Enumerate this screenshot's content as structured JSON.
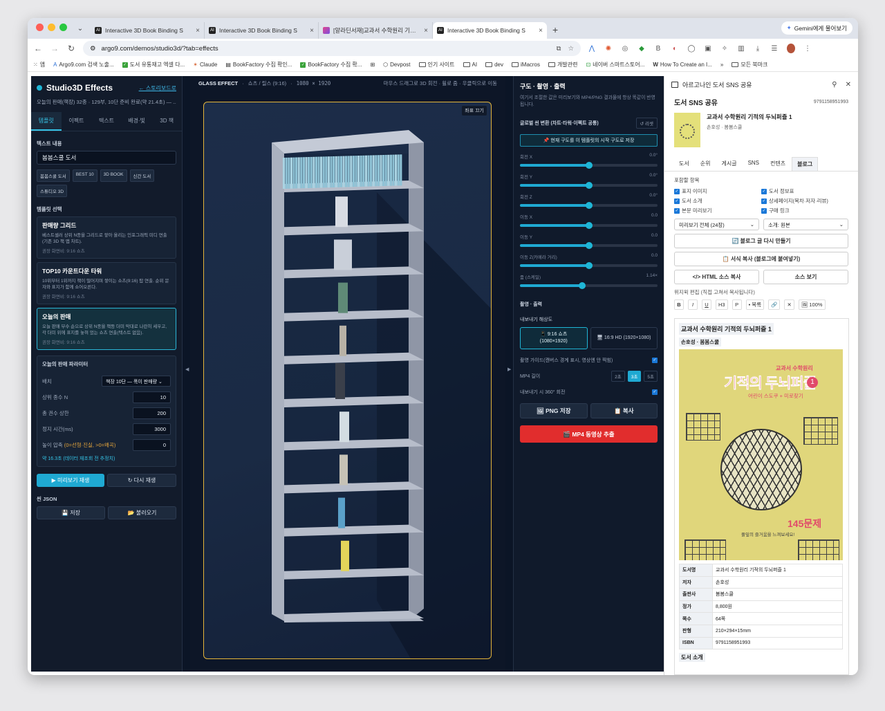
{
  "browser": {
    "tabs": [
      {
        "title": "Interactive 3D Book Binding S",
        "icon": "AI",
        "active": false
      },
      {
        "title": "Interactive 3D Book Binding S",
        "icon": "AI",
        "active": false
      },
      {
        "title": "[알라딘서재]교과서 수학원리 기적의",
        "icon": "aladin",
        "active": false
      },
      {
        "title": "Interactive 3D Book Binding S",
        "icon": "AI",
        "active": true
      }
    ],
    "new_tab": "+",
    "gemini_label": "Gemini에게 물어보기",
    "url": "argo9.com/demos/studio3d/?tab=effects",
    "bookmarks": [
      "앱",
      "Argo9.com 검색 노출...",
      "도서 유통재고 엑셀 다...",
      "Claude",
      "BookFactory 수집 확인...",
      "BookFactory 수집 확...",
      "Devpost",
      "인기 사이트",
      "AI",
      "dev",
      "iMacros",
      "개발관련",
      "네이버 스마트스토어...",
      "How To Create an I...",
      "모든 북마크"
    ]
  },
  "left": {
    "brand": "Studio3D Effects",
    "back_link": "← 스토리보드로",
    "subtitle": "오늘의 판매(책장) 32종 · 129부, 10단 준비 완료(약 21.4초) — ...",
    "tabs": [
      "템플릿",
      "이펙트",
      "텍스트",
      "배경·빛",
      "3D 책"
    ],
    "active_tab": 0,
    "text_label": "텍스트 내용",
    "text_value": "봄봄스쿨 도서",
    "chips": [
      "봄봄스쿨 도서",
      "BEST 10",
      "3D BOOK",
      "신간 도서",
      "스튜디오 3D"
    ],
    "template_label": "템플릿 선택",
    "templates": [
      {
        "title": "판매량 그리드",
        "desc": "베스트셀러 상위 N종을 그리드로 쌓아 올리는 인포그래픽 미디 연출 (기존 3D 책 맵 차트).",
        "rec": "권장 화면비: 9:16 쇼츠"
      },
      {
        "title": "TOP10 카운트다운 타워",
        "desc": "10위부터 1위까지 책이 떨어지며 쌓이는 쇼츠(9:16) 탑 연출. 순위 문자와 표지가 함께 쇼어오른다.",
        "rec": "권장 화면비: 9:16 쇼츠"
      },
      {
        "title": "오늘의 판매",
        "desc": "오늘 판매 부수 순으로 상위 N종을 책등 더미 막대로 나란히 세우고, 각 더미 위에 표지를 놓혀 었는 쇼츠 연출(텍스트 없음).",
        "rec": "권장 화면비: 9:16 쇼츠"
      }
    ],
    "active_template": 2,
    "params_title": "오늘의 판매 파라미터",
    "params": {
      "layout_label": "배치",
      "layout_value": "책장 10단 — 폭이 판매량",
      "topn_label": "상위 종수 N",
      "topn_value": "10",
      "total_label": "총 권수 상한",
      "total_value": "200",
      "stop_label": "정지 시간(ms)",
      "stop_value": "3000",
      "height_label": "높이 압축",
      "height_hint": "(0=선형·진실, >0=왜곡)",
      "height_value": "0",
      "estimate": "약 16.3초 (데이터 재조회 전 추정치)"
    },
    "play_label": "▶ 미리보기 재생",
    "replay_label": "↻ 다시 재생",
    "json_label": "씬 JSON",
    "save_label": "💾 저장",
    "load_label": "📂 불러오기"
  },
  "viewer": {
    "effect": "GLASS EFFECT",
    "mode": "쇼츠 / 릴스 (9:16)",
    "res": "1080 × 1920",
    "hint": "마우스 드래그로 3D 회전 · 휠로 줌 · 우클릭으로 이동",
    "coord_toggle": "좌표 끄기",
    "shelves": 11
  },
  "middle": {
    "title": "구도 · 촬영 · 출력",
    "desc": "여기서 조절한 값은 미리보기와 MP4/PNG 결과물에 항상 똑같이 반영됩니다.",
    "global_title": "글로벌 씬 변환 (차트·타워·이펙트 공통)",
    "reset": "↺ 리셋",
    "save_composition": "📌 현재 구도를 이 템플릿의 시작 구도로 저장",
    "sliders": [
      {
        "label": "회전 X",
        "value": "0.0°",
        "ratio": 0.5
      },
      {
        "label": "회전 Y",
        "value": "0.0°",
        "ratio": 0.5
      },
      {
        "label": "회전 Z",
        "value": "0.0°",
        "ratio": 0.5
      },
      {
        "label": "이동 X",
        "value": "0.0",
        "ratio": 0.5
      },
      {
        "label": "이동 Y",
        "value": "0.0",
        "ratio": 0.5
      },
      {
        "label": "이동 Z(카메라 거리)",
        "value": "0.0",
        "ratio": 0.5
      },
      {
        "label": "줌 (스케일)",
        "value": "1.14×",
        "ratio": 0.45
      }
    ],
    "shoot_title": "촬영 · 출력",
    "res_title": "내보내기 해상도",
    "res_options": [
      "📱 9:16 쇼츠\n(1080×1920)",
      "🖥 16:9 HD (1920×1080)"
    ],
    "guide_label": "촬영 가이드(캔버스 경계 표시, 영상엔 안 찍힘)",
    "mp4_label": "MP4 길이",
    "mp4_options": [
      "2초",
      "3초",
      "5초"
    ],
    "mp4_active": 1,
    "rotate_label": "내보내기 시 360° 회전",
    "png_label": "🖼 PNG 저장",
    "copy_label": "📋 복사",
    "mp4_button": "🎬 MP4 동영상 추출"
  },
  "side": {
    "header": "아르고나인 도서 SNS 공유",
    "title": "도서 SNS 공유",
    "isbn": "9791158951993",
    "book_title": "교과서 수학원리 기적의 두뇌퍼즐 1",
    "book_author": "손호성 · 봄봄스쿨",
    "tabs": [
      "도서",
      "순위",
      "게시글",
      "SNS",
      "컨텐츠",
      "블로그"
    ],
    "active_tab": 5,
    "include_label": "포함할 항목",
    "checks": [
      "표지 이미지",
      "도서 정보표",
      "도서 소개",
      "상세페이지(목차·저자·리뷰)",
      "본문 미리보기",
      "구매 링크"
    ],
    "preview_sel": "미리보기 전체 (24장)",
    "intro_sel": "소개: 원본",
    "remake": "🔄 블로그 글 다시 만들기",
    "copy_format": "📋 서식 복사 (블로그에 붙여넣기)",
    "html_copy": "</> HTML 소스 복사",
    "view_source": "소스 보기",
    "editor_label": "위지윅 편집 (직접 고쳐서 복사됩니다)",
    "editor_tools": [
      "B",
      "I",
      "U",
      "H3",
      "P",
      "• 목록",
      "🔗",
      "✕",
      "🖼 100%"
    ],
    "preview_title": "교과서 수학원리 기적의 두뇌퍼즐 1",
    "preview_sub": "손호성 · 봄봄스쿨",
    "cover": {
      "top": "교과서 수학원리",
      "title": "기적의 두뇌퍼즐",
      "num": "1",
      "sub": "어린이 스도쿠 + 미로찾기",
      "count": "145문제",
      "foot": "풀잎의 즐거움을 느껴보세요!"
    },
    "info_rows": [
      [
        "도서명",
        "교과서 수학원리 기적의 두뇌퍼즐 1"
      ],
      [
        "저자",
        "손호성"
      ],
      [
        "출판사",
        "봄봄스쿨"
      ],
      [
        "정가",
        "8,800원"
      ],
      [
        "쪽수",
        "64쪽"
      ],
      [
        "판형",
        "210×294×15mm"
      ],
      [
        "ISBN",
        "9791158951993"
      ]
    ],
    "intro_heading": "도서 소개"
  },
  "colors": {
    "accent": "#1fb6d6",
    "mp4": "#e12d2d",
    "guide": "#e5b53a"
  }
}
